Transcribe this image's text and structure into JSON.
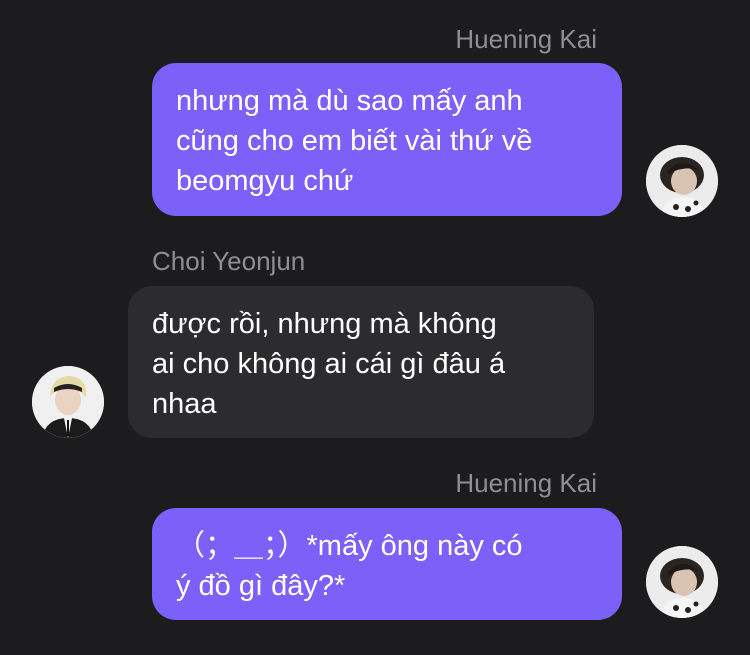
{
  "messages": [
    {
      "sender": "Huening Kai",
      "direction": "outgoing",
      "lines": [
        "nhưng mà dù sao mấy anh",
        "cũng cho em biết vài thứ về",
        "beomgyu chứ"
      ]
    },
    {
      "sender": "Choi Yeonjun",
      "direction": "incoming",
      "lines": [
        "được rồi, nhưng mà không",
        "ai cho không ai cái gì đâu á",
        "nhaa"
      ]
    },
    {
      "sender": "Huening Kai",
      "direction": "outgoing",
      "lines": [
        "（；＿；）*mấy ông này có",
        "ý đồ gì đây?*"
      ]
    }
  ],
  "colors": {
    "background": "#1c1c1e",
    "outgoing_bubble": "#7b61f7",
    "incoming_bubble": "#2c2c2e",
    "sender_name": "#8e8e93",
    "text": "#ffffff"
  }
}
